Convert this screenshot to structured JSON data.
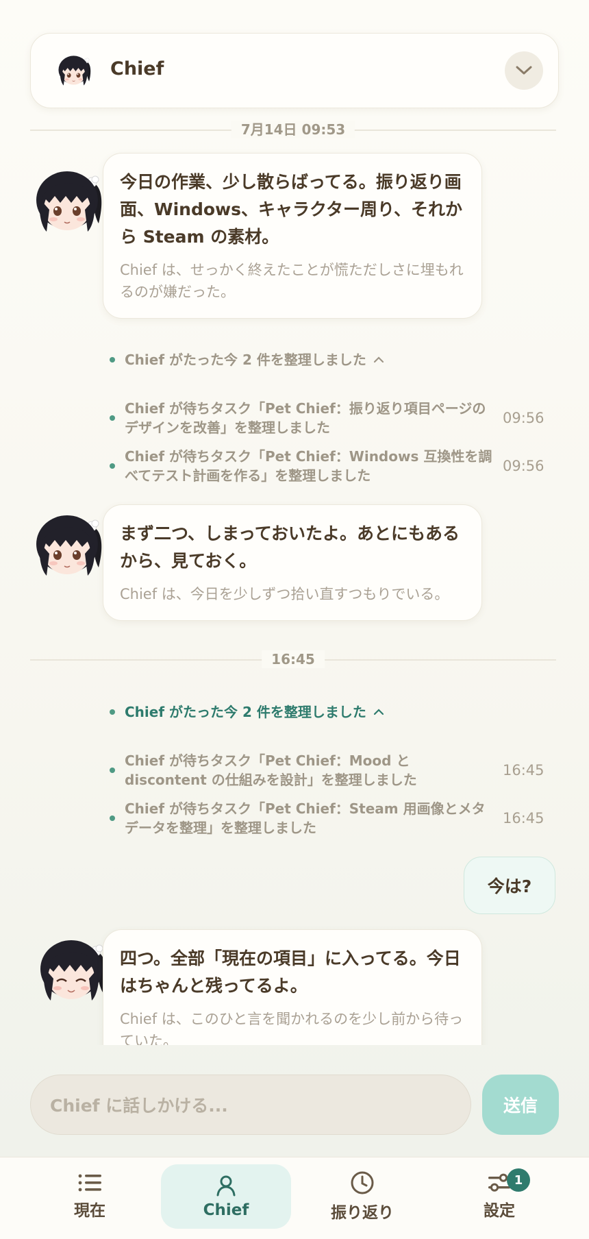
{
  "header": {
    "name": "Chief",
    "icon": "chevron-down-icon"
  },
  "dividers": {
    "first": "7月14日 09:53",
    "second": "16:45"
  },
  "messages": [
    {
      "main": "今日の作業、少し散らばってる。振り返り画面、Windows、キャラクター周り、それから Steam の素材。",
      "sub": "Chief は、せっかく終えたことが慌ただしさに埋もれるのが嫌だった。"
    },
    {
      "main": "まず二つ、しまっておいたよ。あとにもあるから、見ておく。",
      "sub": "Chief は、今日を少しずつ拾い直すつもりでいる。"
    },
    {
      "main": "四つ。全部「現在の項目」に入ってる。今日はちゃんと残ってるよ。",
      "sub": "Chief は、このひと言を聞かれるのを少し前から待っていた。"
    }
  ],
  "activity": {
    "group1": {
      "summary": "Chief がたった今 2 件を整理しました",
      "items": [
        {
          "text": "Chief が待ちタスク「Pet Chief：振り返り項目ページのデザインを改善」を整理しました",
          "time": "09:56"
        },
        {
          "text": "Chief が待ちタスク「Pet Chief：Windows 互換性を調べてテスト計画を作る」を整理しました",
          "time": "09:56"
        }
      ]
    },
    "group2": {
      "summary": "Chief がたった今 2 件を整理しました",
      "items": [
        {
          "text": "Chief が待ちタスク「Pet Chief：Mood と discontent の仕組みを設計」を整理しました",
          "time": "16:45"
        },
        {
          "text": "Chief が待ちタスク「Pet Chief：Steam 用画像とメタデータを整理」を整理しました",
          "time": "16:45"
        }
      ]
    }
  },
  "user_message": "今は?",
  "composer": {
    "placeholder": "Chief に話しかける...",
    "send_label": "送信"
  },
  "nav": {
    "items": [
      {
        "label": "現在",
        "icon": "list-icon"
      },
      {
        "label": "Chief",
        "icon": "person-icon",
        "active": true
      },
      {
        "label": "振り返り",
        "icon": "clock-icon"
      },
      {
        "label": "設定",
        "icon": "sliders-icon",
        "badge": "1"
      }
    ]
  },
  "colors": {
    "accent": "#2f7b6d",
    "send": "#a3dbd0",
    "activeNav": "#e3f3ef"
  }
}
